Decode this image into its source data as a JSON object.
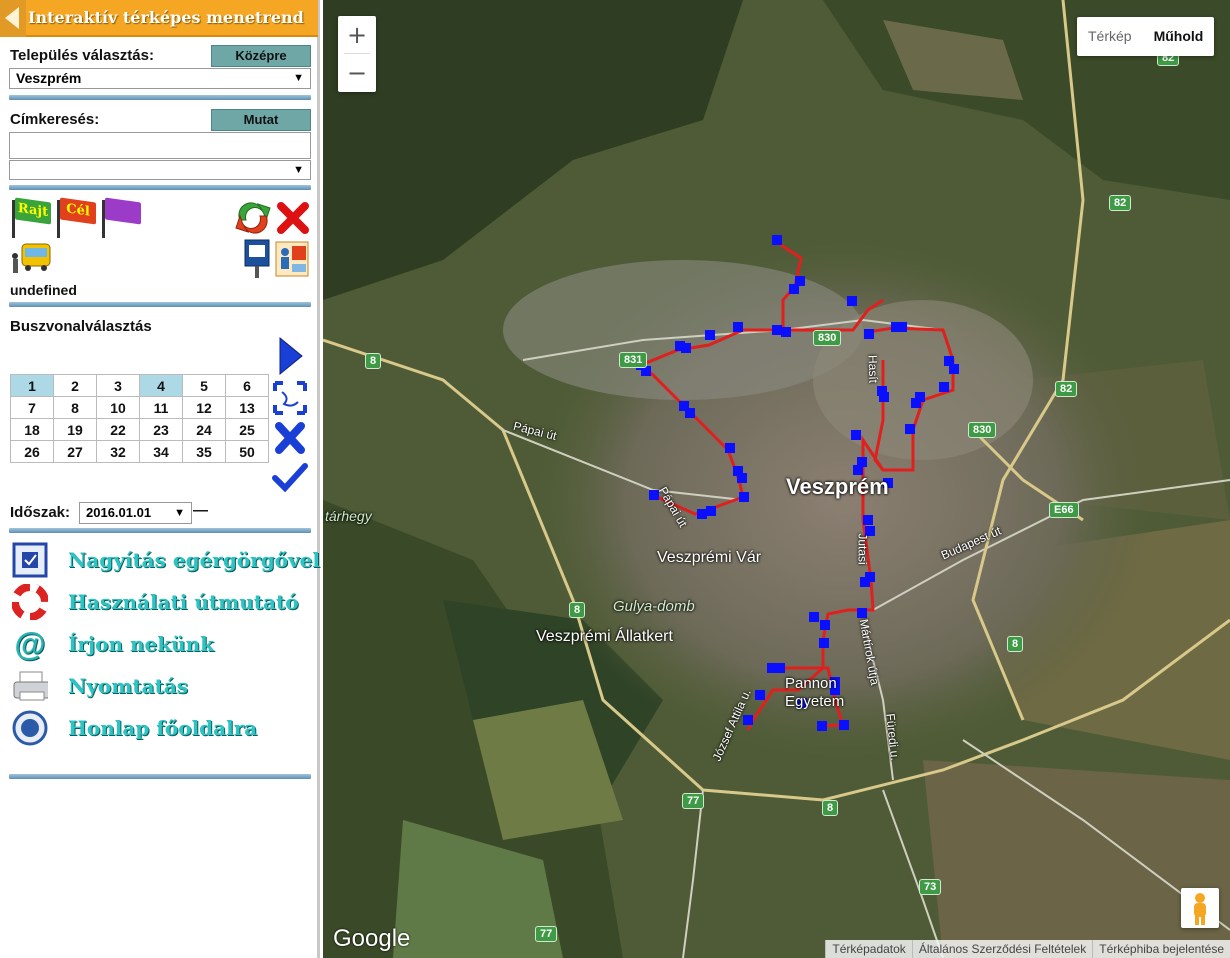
{
  "sidebar": {
    "title": "Interaktív térképes menetrend",
    "settlement_label": "Település választás:",
    "center_button": "Középre",
    "settlement_value": "Veszprém",
    "tag_search_label": "Címkeresés:",
    "show_button": "Mutat",
    "tag_search_value": "",
    "tag_select_value": "",
    "flags": [
      "Rajt",
      "Cél",
      ""
    ],
    "undefined_text": "undefined",
    "bus_line_label": "Buszvonalválasztás",
    "bus_lines": [
      [
        "1",
        "2",
        "3",
        "4",
        "5",
        "6"
      ],
      [
        "7",
        "8",
        "10",
        "11",
        "12",
        "13"
      ],
      [
        "18",
        "19",
        "22",
        "23",
        "24",
        "25"
      ],
      [
        "26",
        "27",
        "32",
        "34",
        "35",
        "50"
      ]
    ],
    "selected_lines": [
      "1",
      "4"
    ],
    "period_label": "Időszak:",
    "period_value": "2016.01.01",
    "period_dash": "—",
    "menu": [
      {
        "label": "Nagyítás egérgörgővel",
        "icon": "zoom-icon"
      },
      {
        "label": "Használati útmutató",
        "icon": "lifebuoy-icon"
      },
      {
        "label": "Írjon nekünk",
        "icon": "at-sign-icon"
      },
      {
        "label": "Nyomtatás",
        "icon": "printer-icon"
      },
      {
        "label": "Honlap főoldalra",
        "icon": "home-logo-icon"
      }
    ]
  },
  "map": {
    "zoom_in": "+",
    "zoom_out": "−",
    "type_map": "Térkép",
    "type_satellite": "Műhold",
    "city_label": "Veszprém",
    "labels": {
      "castle": "Veszprémi Vár",
      "zoo": "Veszprémi Állatkert",
      "hill": "Gulya-domb",
      "university": "Pannon Egyetem",
      "papai_ut": "Pápai út",
      "papai_ut2": "Pápai út",
      "budapest_ut": "Budapest út",
      "martirok": "Mártírok útja",
      "furedi": "Füredi u.",
      "jozsef": "József Attila u.",
      "tarhegy": "tárhegy",
      "hasit": "Hasít",
      "road_node": "Jutasi"
    },
    "shields": [
      "8",
      "8",
      "8",
      "8",
      "82",
      "82",
      "82",
      "830",
      "830",
      "831",
      "E66",
      "77",
      "77",
      "73"
    ],
    "google_logo": "Google",
    "attribution": [
      "Térképadatok",
      "Általános Szerződési Feltételek",
      "Térképhiba bejelentése"
    ],
    "colors": {
      "route": "#e0201e",
      "stop": "#0a10ff"
    }
  }
}
